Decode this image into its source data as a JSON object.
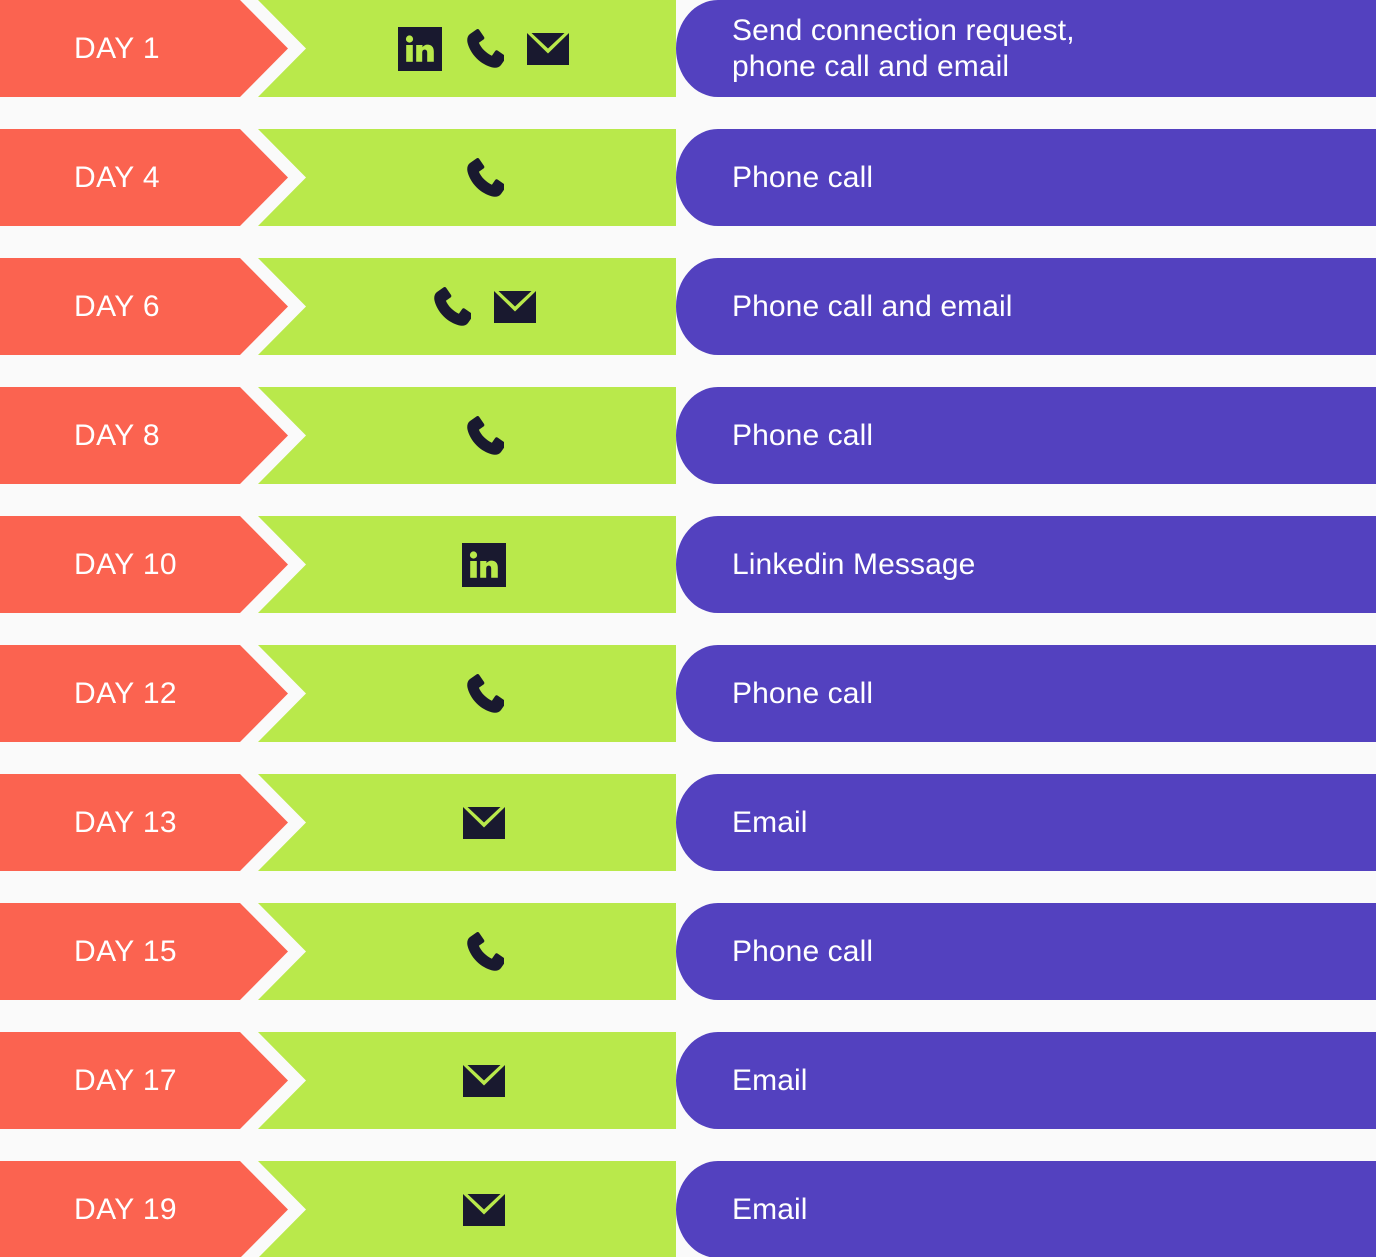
{
  "colors": {
    "background": "#fafafa",
    "day_chip": "#fb6350",
    "channel_chip": "#b9e94b",
    "desc_chip": "#5341bf",
    "icon_dark": "#19192f",
    "text_light": "#ffffff"
  },
  "rows": [
    {
      "day": "DAY 1",
      "icons": [
        "linkedin-icon",
        "phone-icon",
        "email-icon"
      ],
      "description": "Send connection request,\nphone call and email"
    },
    {
      "day": "DAY 4",
      "icons": [
        "phone-icon"
      ],
      "description": "Phone call"
    },
    {
      "day": "DAY 6",
      "icons": [
        "phone-icon",
        "email-icon"
      ],
      "description": "Phone call and email"
    },
    {
      "day": "DAY 8",
      "icons": [
        "phone-icon"
      ],
      "description": "Phone call"
    },
    {
      "day": "DAY 10",
      "icons": [
        "linkedin-icon"
      ],
      "description": "Linkedin Message"
    },
    {
      "day": "DAY 12",
      "icons": [
        "phone-icon"
      ],
      "description": "Phone call"
    },
    {
      "day": "DAY 13",
      "icons": [
        "email-icon"
      ],
      "description": "Email"
    },
    {
      "day": "DAY 15",
      "icons": [
        "phone-icon"
      ],
      "description": "Phone call"
    },
    {
      "day": "DAY 17",
      "icons": [
        "email-icon"
      ],
      "description": "Email"
    },
    {
      "day": "DAY 19",
      "icons": [
        "email-icon"
      ],
      "description": "Email"
    }
  ]
}
